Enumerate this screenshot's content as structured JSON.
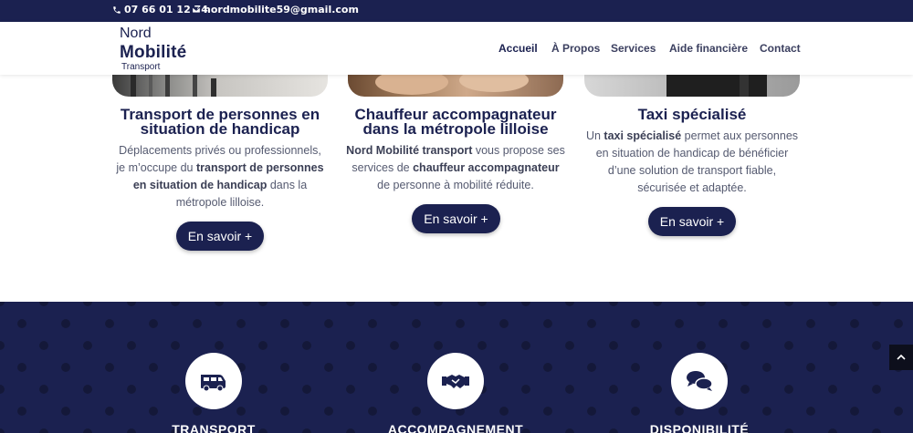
{
  "topbar": {
    "phone": "07 66 01 12 74",
    "email": "nordmobilite59@gmail.com"
  },
  "logo": {
    "line1": "Nord",
    "line2": "Mobilité",
    "line3": "Transport"
  },
  "nav": {
    "items": [
      {
        "label": "Accueil",
        "active": true
      },
      {
        "label": "À Propos"
      },
      {
        "label": "Services"
      },
      {
        "label": "Aide financière"
      },
      {
        "label": "Contact"
      }
    ]
  },
  "cards": [
    {
      "title_line1": "Transport de personnes en",
      "title_line2": "situation de handicap",
      "text_l1": "Déplacements privés ou professionnels,",
      "text_l2_a": "je m’occupe du ",
      "text_l2_b": "transport de personnes",
      "text_l3_a": "en situation de handicap",
      "text_l3_b": " dans la",
      "text_l4": "métropole lilloise.",
      "button": "En savoir +"
    },
    {
      "title_line1": "Chauffeur accompagnateur",
      "title_line2": "dans la métropole lilloise",
      "text_l1_a": "Nord Mobilité transport",
      "text_l1_b": " vous propose ses",
      "text_l2_a": "services de ",
      "text_l2_b": "chauffeur accompagnateur",
      "text_l3": "de personne à mobilité réduite.",
      "button": "En savoir +"
    },
    {
      "title_line1": "Taxi spécialisé",
      "text_l1_a": "Un ",
      "text_l1_b": "taxi spécialisé",
      "text_l1_c": " permet aux personnes",
      "text_l2": "en situation de handicap de bénéficier",
      "text_l3": "d’une solution de transport fiable,",
      "text_l4": "sécurisée et adaptée.",
      "button": "En savoir +"
    }
  ],
  "features": [
    {
      "icon": "van-icon",
      "label": "TRANSPORT"
    },
    {
      "icon": "handshake-icon",
      "label": "ACCOMPAGNEMENT"
    },
    {
      "icon": "chat-bubbles-icon",
      "label": "DISPONIBILITÉ"
    }
  ],
  "colors": {
    "navy": "#1b2150",
    "dot": "#15193f"
  }
}
